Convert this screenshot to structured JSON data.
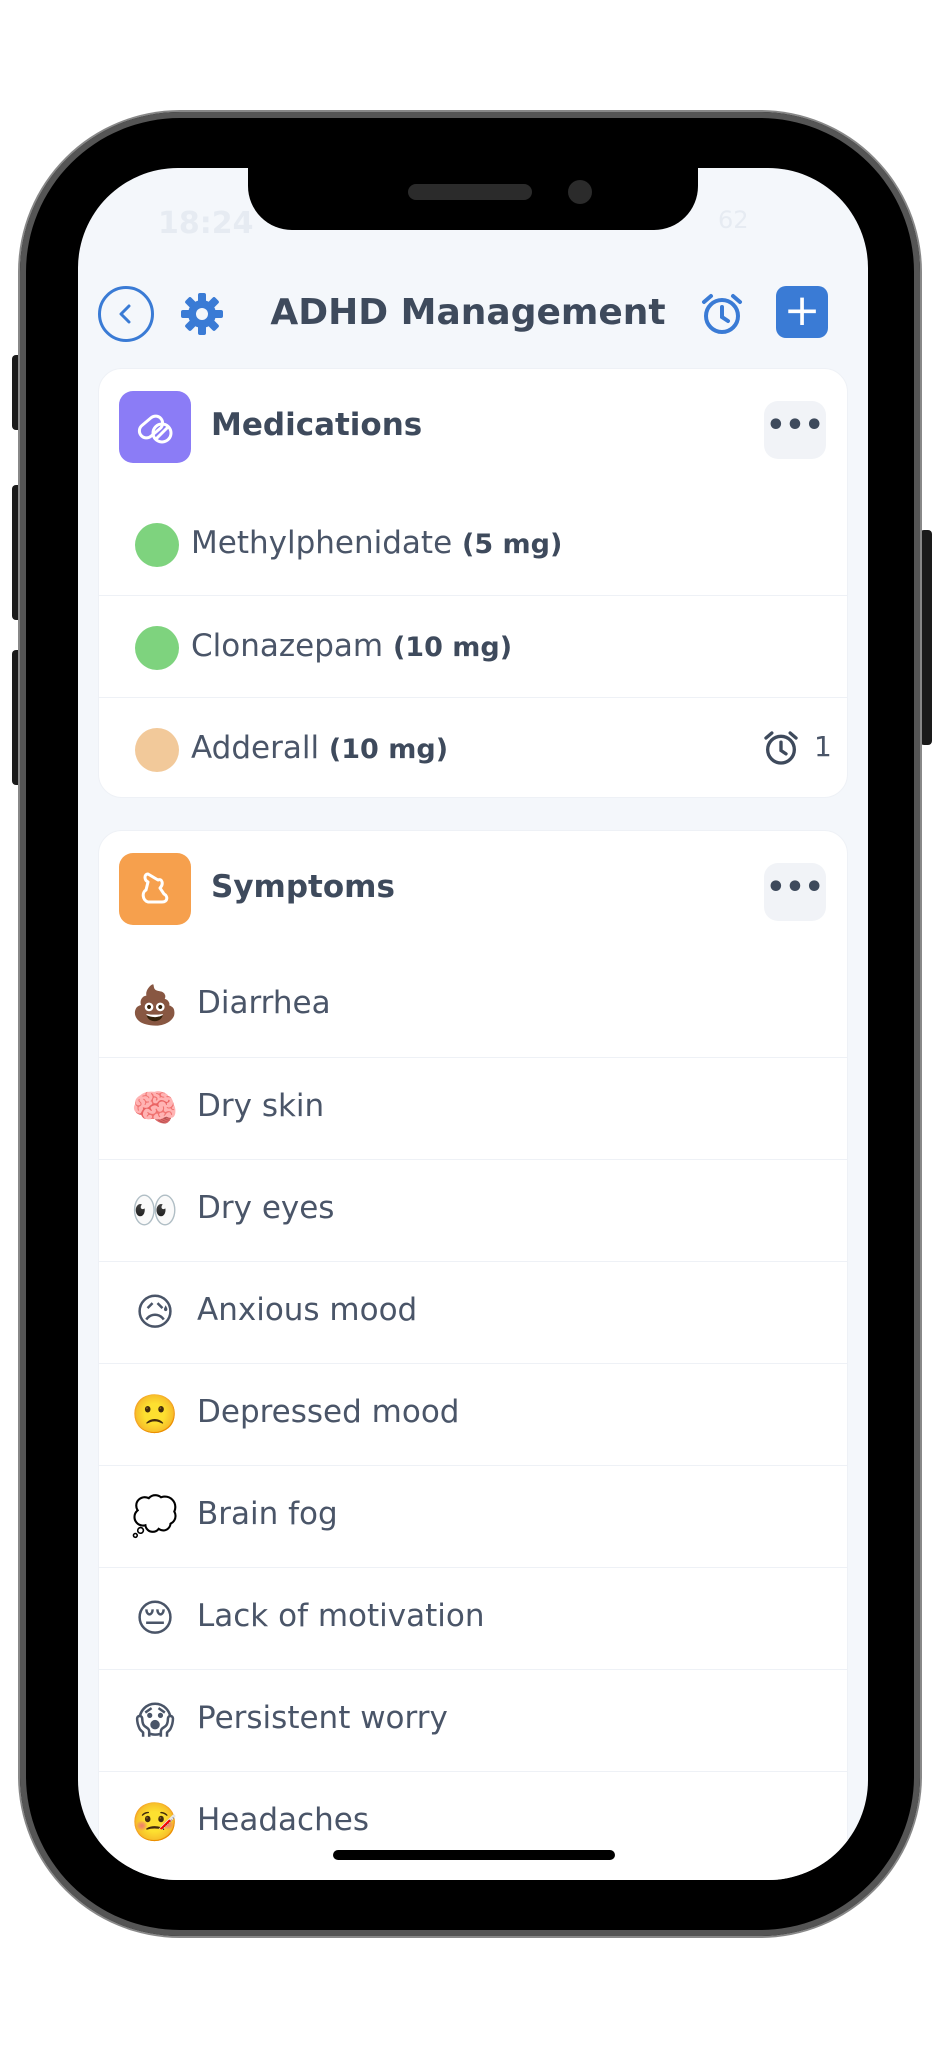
{
  "status": {
    "time": "18:24",
    "battery": "62"
  },
  "header": {
    "title": "ADHD Management",
    "add_label": "+"
  },
  "medications": {
    "title": "Medications",
    "more_label": "•••",
    "items": [
      {
        "name": "Methylphenidate",
        "dose": "(5 mg)",
        "pill_color": "#7ed37e"
      },
      {
        "name": "Clonazepam",
        "dose": "(10 mg)",
        "pill_color": "#7ed37e"
      },
      {
        "name": "Adderall",
        "dose": "(10 mg)",
        "pill_color": "#f2c99a",
        "reminder_count": "1"
      }
    ]
  },
  "symptoms": {
    "title": "Symptoms",
    "more_label": "•••",
    "items": [
      {
        "emoji": "💩",
        "name": "Diarrhea"
      },
      {
        "emoji": "🧠",
        "name": "Dry skin"
      },
      {
        "emoji": "👀",
        "name": "Dry eyes"
      },
      {
        "emoji": "😥",
        "name": "Anxious mood"
      },
      {
        "emoji": "🙁",
        "name": "Depressed mood"
      },
      {
        "emoji": "💭",
        "name": "Brain fog"
      },
      {
        "emoji": "😔",
        "name": "Lack of motivation"
      },
      {
        "emoji": "😱",
        "name": "Persistent worry"
      },
      {
        "emoji": "🤒",
        "name": "Headaches"
      }
    ]
  },
  "colors": {
    "accent": "#3a7bd5",
    "medications_icon": "#8b7cf6",
    "symptoms_icon": "#f6a04d"
  }
}
